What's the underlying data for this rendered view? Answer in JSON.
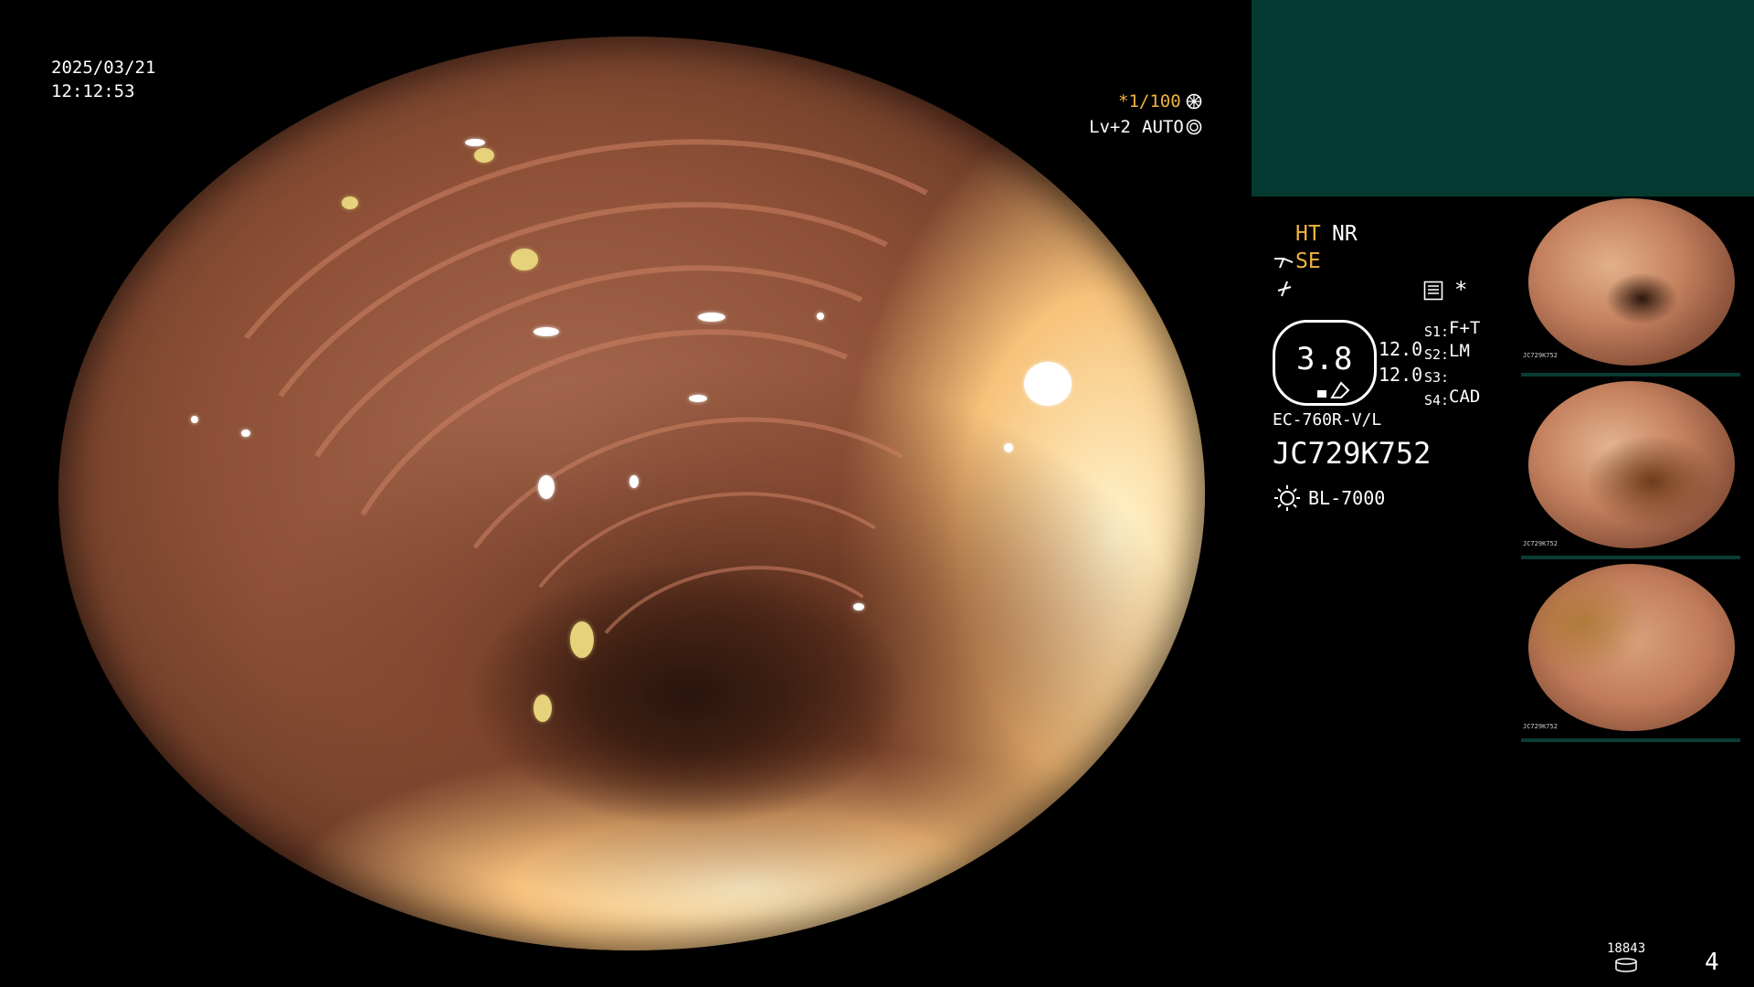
{
  "overlay": {
    "date": "2025/03/21",
    "time": "12:12:53",
    "shutter": "*1/100",
    "level": "Lv+2",
    "mode": "AUTO"
  },
  "settings": {
    "ht": "HT",
    "nr": "NR",
    "se": "SE",
    "zoom": "3.8",
    "value_1": "12.0",
    "value_2": "12.0",
    "s1_label": "S1:",
    "s1_value": "F+T",
    "s2_label": "S2:",
    "s2_value": "LM",
    "s3_label": "S3:",
    "s3_value": "",
    "s4_label": "S4:",
    "s4_value": "CAD",
    "asterisk": "*",
    "scope_model": "EC-760R-V/L",
    "serial": "JC729K752",
    "light_source": "BL-7000"
  },
  "thumbnails": [
    {
      "label": "JC729K752"
    },
    {
      "label": "JC729K752"
    },
    {
      "label": "JC729K752"
    }
  ],
  "footer": {
    "storage_count": "18843",
    "page_number": "4"
  },
  "colors": {
    "accent_orange": "#f0b43c",
    "panel_teal": "#053a32"
  }
}
